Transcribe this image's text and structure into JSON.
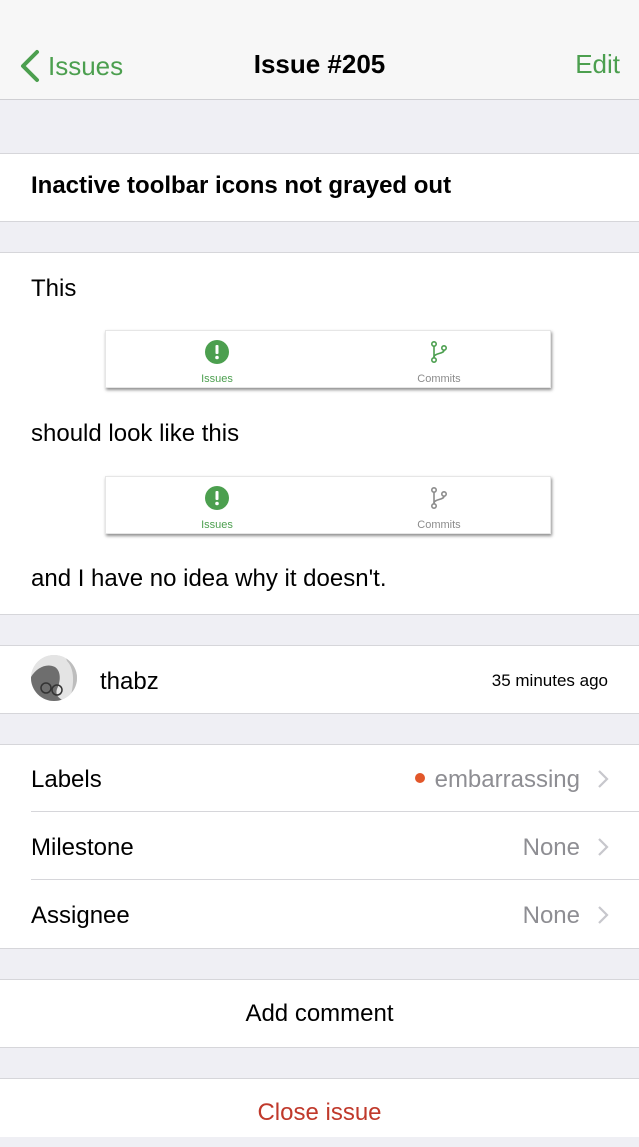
{
  "nav": {
    "back_label": "Issues",
    "title": "Issue #205",
    "edit_label": "Edit"
  },
  "issue": {
    "title": "Inactive toolbar icons not grayed out",
    "body": {
      "line1": "This",
      "line2": "should look like this",
      "line3": "and I have no idea why it doesn't."
    },
    "screenshot_tabs": {
      "issues": "Issues",
      "commits": "Commits"
    }
  },
  "author": {
    "name": "thabz",
    "time": "35 minutes ago"
  },
  "details": [
    {
      "label": "Labels",
      "value": "embarrassing",
      "dot_color": "#e2572a"
    },
    {
      "label": "Milestone",
      "value": "None"
    },
    {
      "label": "Assignee",
      "value": "None"
    }
  ],
  "actions": {
    "add_comment": "Add comment",
    "close_issue": "Close issue"
  },
  "colors": {
    "accent": "#4c9f4f",
    "danger": "#c0392b"
  }
}
